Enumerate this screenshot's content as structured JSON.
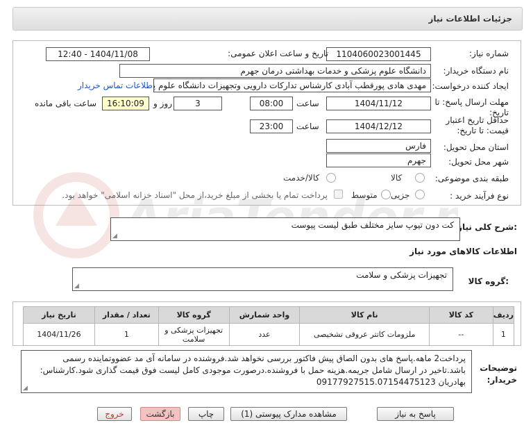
{
  "header": {
    "title": "جزئیات اطلاعات نیاز"
  },
  "need_number": {
    "label": "شماره نیاز:",
    "value": "1104060023001445"
  },
  "announce_datetime": {
    "label": "تاریخ و ساعت اعلان عمومی:",
    "value": "1404/11/08 - 12:40"
  },
  "buyer_org": {
    "label": "نام دستگاه خریدار:",
    "value": "دانشگاه علوم پزشکی و خدمات بهداشتی  درمان جهرم"
  },
  "requester": {
    "label": "ایجاد کننده درخواست:",
    "value": "مهدی هادی پورقطب آبادی کارشناس تدارکات دارویی وتجهیزات دانشگاه علوم پزشکی",
    "contact_link": "اطلاعات تماس خریدار"
  },
  "reply_deadline": {
    "label": "مهلت ارسال پاسخ: تا تاریخ:",
    "date": "1404/11/12",
    "time_label": "ساعت",
    "time": "08:00",
    "days": "3",
    "days_label": "روز و",
    "remaining_time": "16:10:09",
    "remaining_label": "ساعت باقی مانده"
  },
  "price_validity": {
    "label": "حداقل تاریخ اعتبار قیمت: تا تاریخ:",
    "date": "1404/12/12",
    "time_label": "ساعت",
    "time": "23:00"
  },
  "delivery_province": {
    "label": "استان محل تحویل:",
    "value": "فارس"
  },
  "delivery_city": {
    "label": "شهر محل تحویل:",
    "value": "جهرم"
  },
  "category": {
    "label": "طبقه بندی موضوعی:",
    "options": [
      "کالا",
      "کالا/خدمت"
    ]
  },
  "process_type": {
    "label": "نوع فرآیند خرید :",
    "options": [
      "جزیی",
      "متوسط"
    ],
    "payment_note": "پرداخت تمام یا بخشی از مبلغ خرید،از محل \"اسناد خزانه اسلامی\" خواهد بود."
  },
  "general_description": {
    "label": "شرح کلی نیاز:",
    "value": "کت دون تیوپ سایز مختلف طبق لیست پیوست"
  },
  "goods_section": {
    "title": "اطلاعات کالاهای مورد نیاز"
  },
  "goods_group": {
    "label": "گروه کالا:",
    "value": "تجهیزات پزشکی و سلامت"
  },
  "items_table": {
    "headers": [
      "ردیف",
      "کد کالا",
      "نام کالا",
      "واحد شمارش",
      "گروه کالا",
      "تعداد / مقدار",
      "تاریخ نیاز"
    ],
    "rows": [
      [
        "1",
        "--",
        "ملزومات کاتتر عروقی تشخیصی",
        "عدد",
        "تجهیزات پزشکی و سلامت",
        "1",
        "1404/11/26"
      ]
    ]
  },
  "buyer_notes": {
    "label": "توضیحات خریدار:",
    "value": "پرداخت2 ماهه.پاسخ های بدون الصاق پیش فاکتور بررسی نخواهد شد.فروشنده در سامانه آی مد عضووتمایندە رسمی باشد.تاخیر در ارسال شامل جریمه.هزینه حمل با فروشنده.درصورت موجودی کامل لیست فوق قیمت گذاری شود.کارشناس: بهادریان 09177927515.07154475123"
  },
  "buttons": {
    "reply": "پاسخ به نیاز",
    "attachments": "مشاهده مدارک پیوستی (1)",
    "print": "چاپ",
    "back": "بازگشت",
    "exit": "خروج"
  }
}
